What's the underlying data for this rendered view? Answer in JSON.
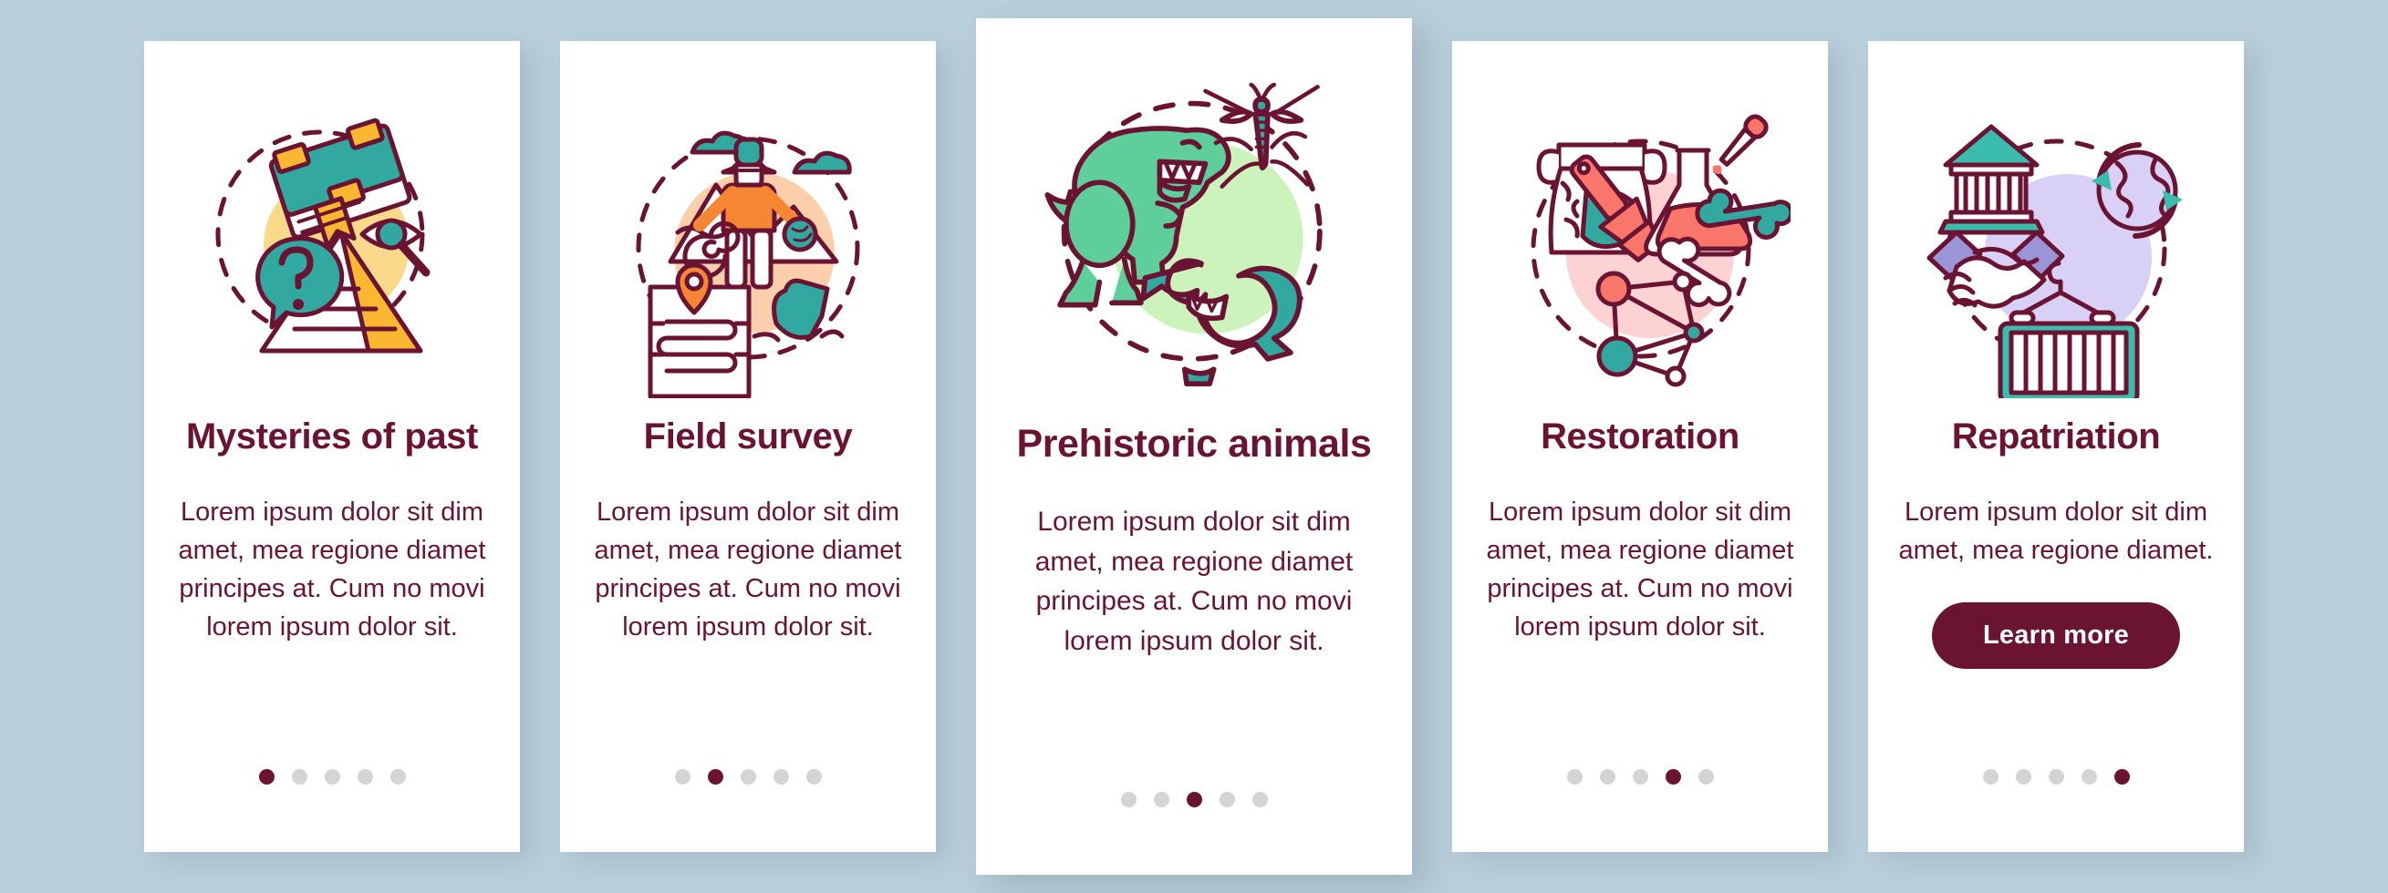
{
  "background_color": "#b9cfdb",
  "theme": {
    "accent": "#6b1333",
    "card_background": "#ffffff",
    "dot_inactive": "#d4d4d4",
    "dot_active": "#6b1333"
  },
  "screens": [
    {
      "id": "mysteries-of-past",
      "illustration_name": "book-question-pyramid-magnifier-icon",
      "title": "Mysteries of past",
      "body": "Lorem ipsum dolor sit dim amet, mea regione diamet principes at. Cum no movi lorem ipsum dolor sit.",
      "active_dot": 0,
      "dot_count": 5,
      "has_button": false,
      "button_label": ""
    },
    {
      "id": "field-survey",
      "illustration_name": "explorer-mountains-map-artifact-icon",
      "title": "Field survey",
      "body": "Lorem ipsum dolor sit dim amet, mea regione diamet principes at. Cum no movi lorem ipsum dolor sit.",
      "active_dot": 1,
      "dot_count": 5,
      "has_button": false,
      "button_label": ""
    },
    {
      "id": "prehistoric-animals",
      "illustration_name": "dinosaur-sea-serpent-mosquito-icon",
      "title": "Prehistoric animals",
      "body": "Lorem ipsum dolor sit dim amet, mea regione diamet principes at. Cum no movi lorem ipsum dolor sit.",
      "active_dot": 2,
      "dot_count": 5,
      "has_button": false,
      "button_label": ""
    },
    {
      "id": "restoration",
      "illustration_name": "amphora-brush-flask-bones-molecule-icon",
      "title": "Restoration",
      "body": "Lorem ipsum dolor sit dim amet, mea regione diamet principes at. Cum no movi lorem ipsum dolor sit.",
      "active_dot": 3,
      "dot_count": 5,
      "has_button": false,
      "button_label": ""
    },
    {
      "id": "repatriation",
      "illustration_name": "museum-handshake-globe-crate-icon",
      "title": "Repatriation",
      "body": "Lorem ipsum dolor sit dim amet, mea regione diamet.",
      "active_dot": 4,
      "dot_count": 5,
      "has_button": true,
      "button_label": "Learn more"
    }
  ]
}
